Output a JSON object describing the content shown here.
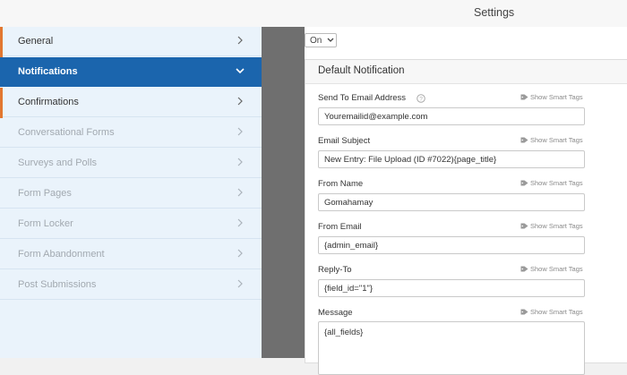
{
  "header": {
    "title": "Settings"
  },
  "sidebar": {
    "items": [
      {
        "label": "General",
        "state": "normal"
      },
      {
        "label": "Notifications",
        "state": "active"
      },
      {
        "label": "Confirmations",
        "state": "normal"
      },
      {
        "label": "Conversational Forms",
        "state": "disabled"
      },
      {
        "label": "Surveys and Polls",
        "state": "disabled"
      },
      {
        "label": "Form Pages",
        "state": "disabled"
      },
      {
        "label": "Form Locker",
        "state": "disabled"
      },
      {
        "label": "Form Abandonment",
        "state": "disabled"
      },
      {
        "label": "Post Submissions",
        "state": "disabled"
      }
    ]
  },
  "main": {
    "toggle": {
      "value": "On"
    },
    "panel": {
      "title": "Default Notification",
      "smart_tags_label": "Show Smart Tags",
      "fields": [
        {
          "label": "Send To Email Address",
          "value": "Youremailid@example.com",
          "has_help": true
        },
        {
          "label": "Email Subject",
          "value": "New Entry: File Upload (ID #7022){page_title}"
        },
        {
          "label": "From Name",
          "value": "Gomahamay"
        },
        {
          "label": "From Email",
          "value": "{admin_email}"
        },
        {
          "label": "Reply-To",
          "value": "{field_id=\"1\"}"
        },
        {
          "label": "Message",
          "value": "{all_fields}"
        }
      ]
    }
  },
  "colors": {
    "sidebar_bg": "#eaf3fb",
    "active_bg": "#1b65ad",
    "accent": "#e27730",
    "disabled_text": "#a2a9b0"
  }
}
